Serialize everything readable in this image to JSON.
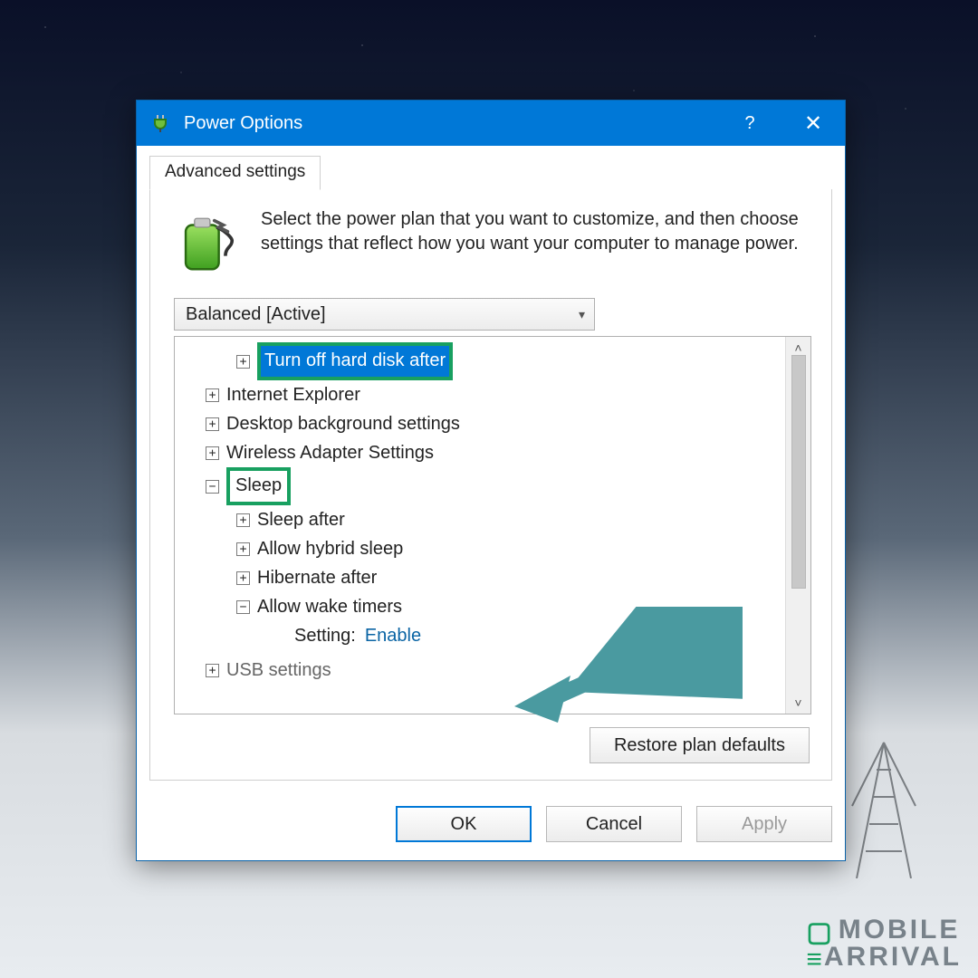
{
  "titlebar": {
    "title": "Power Options",
    "help_label": "?",
    "close_label": "✕"
  },
  "tabs": {
    "advanced": "Advanced settings"
  },
  "intro_text": "Select the power plan that you want to customize, and then choose settings that reflect how you want your computer to manage power.",
  "plan_select": {
    "value": "Balanced [Active]"
  },
  "tree": {
    "hard_disk_after": "Turn off hard disk after",
    "ie": "Internet Explorer",
    "desktop_bg": "Desktop background settings",
    "wireless": "Wireless Adapter Settings",
    "sleep": "Sleep",
    "sleep_after": "Sleep after",
    "hybrid": "Allow hybrid sleep",
    "hibernate": "Hibernate after",
    "wake_timers": "Allow wake timers",
    "setting_label": "Setting:",
    "setting_value": "Enable",
    "usb": "USB settings"
  },
  "buttons": {
    "restore": "Restore plan defaults",
    "ok": "OK",
    "cancel": "Cancel",
    "apply": "Apply"
  },
  "watermark": {
    "line1": "MOBILE",
    "line2": "ARRIVAL"
  },
  "annotations": {
    "highlight_color": "#18a060",
    "arrow_color": "#4a9aa0"
  }
}
